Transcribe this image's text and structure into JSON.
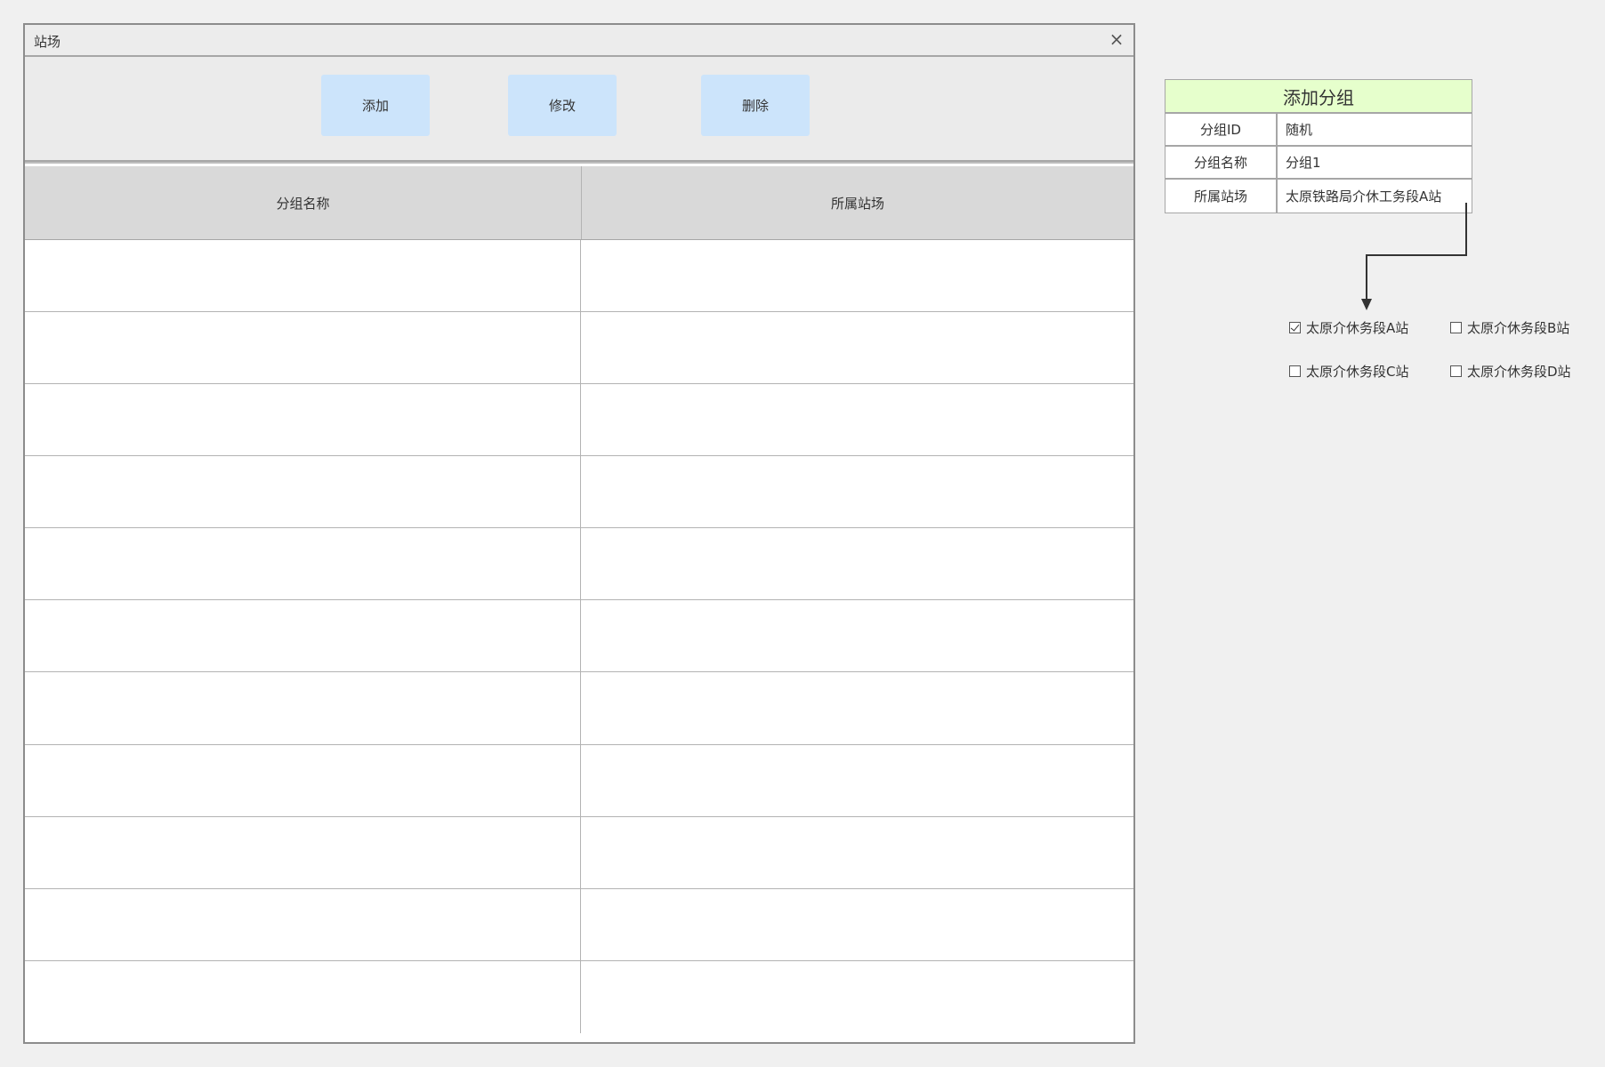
{
  "window": {
    "title": "站场",
    "close_label": "×"
  },
  "toolbar": {
    "add_label": "添加",
    "edit_label": "修改",
    "delete_label": "删除"
  },
  "table": {
    "columns": [
      "分组名称",
      "所属站场"
    ],
    "rows": [
      [
        "",
        ""
      ],
      [
        "",
        ""
      ],
      [
        "",
        ""
      ],
      [
        "",
        ""
      ],
      [
        "",
        ""
      ],
      [
        "",
        ""
      ],
      [
        "",
        ""
      ],
      [
        "",
        ""
      ],
      [
        "",
        ""
      ],
      [
        "",
        ""
      ],
      [
        "",
        ""
      ]
    ]
  },
  "add_group_form": {
    "title": "添加分组",
    "fields": [
      {
        "label": "分组ID",
        "value": "随机"
      },
      {
        "label": "分组名称",
        "value": "分组1"
      },
      {
        "label": "所属站场",
        "value": "太原铁路局介休工务段A站"
      }
    ]
  },
  "station_options": [
    {
      "label": "太原介休务段A站",
      "checked": true
    },
    {
      "label": "太原介休务段B站",
      "checked": false
    },
    {
      "label": "太原介休务段C站",
      "checked": false
    },
    {
      "label": "太原介休务段D站",
      "checked": false
    }
  ],
  "colors": {
    "background": "#f0f0f0",
    "button_fill": "#cce4fb",
    "header_fill": "#d9d9d9",
    "form_title_fill": "#e6ffcc"
  }
}
